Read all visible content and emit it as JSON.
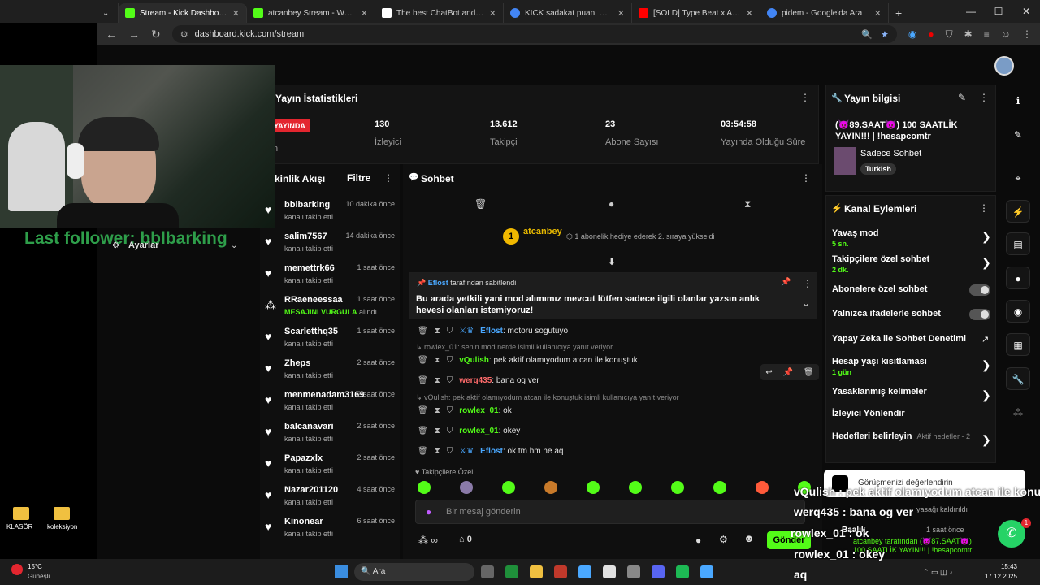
{
  "browser": {
    "tabs": [
      {
        "title": "Stream - Kick Dashboard",
        "color": "#53fc18"
      },
      {
        "title": "atcanbey Stream - Watch Live o",
        "color": "#53fc18"
      },
      {
        "title": "The best ChatBot and Widg",
        "color": "#ffffff"
      },
      {
        "title": "KİCK sadakat puanı mute - Goo",
        "color": "#4285f4"
      },
      {
        "title": "[SOLD] Type Beat x AFRO Type",
        "color": "#ff0000"
      },
      {
        "title": "pidem - Google'da Ara",
        "color": "#4285f4"
      }
    ],
    "url": "dashboard.kick.com/stream"
  },
  "stats": {
    "title": "Yayın İstatistikleri",
    "live_badge": "YAYINDA",
    "live_sub": "ın",
    "items": [
      {
        "value": "130",
        "label": "İzleyici"
      },
      {
        "value": "13.612",
        "label": "Takipçi"
      },
      {
        "value": "23",
        "label": "Abone Sayısı"
      },
      {
        "value": "03:54:58",
        "label": "Yayında Olduğu Süre"
      }
    ]
  },
  "activity": {
    "title": "tkinlik Akışı",
    "filter": "Filtre",
    "items": [
      {
        "name": "bblbarking",
        "sub": "kanalı takip etti",
        "time": "10 dakika önce",
        "icon": "heart-icon"
      },
      {
        "name": "salim7567",
        "sub": "kanalı takip etti",
        "time": "14 dakika önce",
        "icon": "heart-icon"
      },
      {
        "name": "memettrk66",
        "sub": "kanalı takip etti",
        "time": "1 saat önce",
        "icon": "heart-icon"
      },
      {
        "name": "RRaeneessaa",
        "sub": "MESAJINI VURGULA",
        "sub2": "alındı",
        "time": "1 saat önce",
        "icon": "points-icon"
      },
      {
        "name": "Scarletthq35",
        "sub": "kanalı takip etti",
        "time": "1 saat önce",
        "icon": "heart-icon"
      },
      {
        "name": "Zheps",
        "sub": "kanalı takip etti",
        "time": "2 saat önce",
        "icon": "heart-icon"
      },
      {
        "name": "menmenadam3169",
        "sub": "kanalı takip etti",
        "time": "2 saat önce",
        "icon": "heart-icon"
      },
      {
        "name": "balcanavari",
        "sub": "kanalı takip etti",
        "time": "2 saat önce",
        "icon": "heart-icon"
      },
      {
        "name": "Papazxlx",
        "sub": "kanalı takip etti",
        "time": "2 saat önce",
        "icon": "heart-icon"
      },
      {
        "name": "Nazar201120",
        "sub": "kanalı takip etti",
        "time": "4 saat önce",
        "icon": "heart-icon"
      },
      {
        "name": "Kinonear",
        "sub": "kanalı takip etti",
        "time": "6 saat önce",
        "icon": "heart-icon"
      }
    ]
  },
  "chat": {
    "title": "Sohbet",
    "gift_user": "atcanbey",
    "gift_count": "1",
    "gift_text": "1 abonelik hediye ederek 2. sıraya yükseldi",
    "pinned_by": "Eflost",
    "pinned_label": "tarafından sabitlendi",
    "pinned_text": "Bu arada yetkili yani mod alımımız mevcut lütfen sadece ilgili olanlar yazsın anlık hevesi olanları istemiyoruz!",
    "messages": [
      {
        "user": "Eflost",
        "text": "motoru sogutuyo",
        "color": "#4aa8ff"
      },
      {
        "reply": "rowlex_01: senin mod nerde isimli kullanıcıya yanıt veriyor"
      },
      {
        "user": "vQulish",
        "text": "pek aktif olamıyodum atcan ile konuştuk",
        "color": "#53fc18"
      },
      {
        "user": "werq435",
        "text": "bana og ver",
        "color": "#ff6b6b"
      },
      {
        "reply": "vQulish: pek aktif olamıyodum atcan ile konuştuk isimli kullanıcıya yanıt veriyor"
      },
      {
        "user": "rowlex_01",
        "text": "ok",
        "color": "#53fc18"
      },
      {
        "user": "rowlex_01",
        "text": "okey",
        "color": "#53fc18"
      },
      {
        "user": "Eflost",
        "text": "ok tm hm ne aq",
        "color": "#4aa8ff"
      }
    ],
    "emote_tab": "Takipçilere Özel",
    "placeholder": "Bir mesaj gönderin",
    "points": "0",
    "send": "Gönder"
  },
  "info": {
    "title": "Yayın bilgisi",
    "stream_title": "(😈89.SAAT😈) 100 SAATLİK YAYIN!!! | !hesapcomtr",
    "category": "Sadece Sohbet",
    "tag": "Turkish"
  },
  "actions": {
    "title": "Kanal Eylemleri",
    "items": [
      {
        "label": "Yavaş mod",
        "sub": "5 sn.",
        "kind": "chevron"
      },
      {
        "label": "Takipçilere özel sohbet",
        "sub": "2 dk.",
        "kind": "chevron"
      },
      {
        "label": "Abonelere özel sohbet",
        "kind": "toggle"
      },
      {
        "label": "Yalnızca ifadelerle sohbet",
        "kind": "toggle"
      },
      {
        "label": "Yapay Zeka ile Sohbet Denetimi",
        "kind": "link"
      },
      {
        "label": "Hesap yaşı kısıtlaması",
        "sub": "1 gün",
        "kind": "chevron"
      },
      {
        "label": "Yasaklanmış kelimeler",
        "kind": "chevron"
      },
      {
        "label": "İzleyici Yönlendir",
        "kind": "none"
      },
      {
        "label": "Hedefleri belirleyin",
        "sub": "Aktif hedefler - 2",
        "kind": "chevron"
      }
    ]
  },
  "overlay": {
    "follower": "Last follower: bblbarking",
    "settings": "Ayarlar",
    "popup": "Görüşmenizi değerlendirin",
    "banned": "yasağı kaldırıldı",
    "badge": "1",
    "ov_lines": [
      {
        "text": "vQulish : pek aktif olamıyodum atcan ile konuş"
      },
      {
        "text": "werq435 : bana og ver"
      },
      {
        "text": "rowlex_01 : ok"
      },
      {
        "text": "rowlex_01 : okey"
      },
      {
        "text": "aq"
      }
    ],
    "mini_user": "Baalık",
    "mini_time": "1 saat önce",
    "mini_text": "atcanbey tarafından (😈87.SAAT😈) 100 SAATLİK YAYIN!!! | !hesapcomtr"
  },
  "desktop": {
    "icon1": "KLASÖR",
    "icon2": "koleksiyon"
  },
  "taskbar": {
    "weather": "15°C",
    "weather_sub": "Güneşli",
    "search": "Ara",
    "time": "15:43",
    "date": "17.12.2025"
  }
}
